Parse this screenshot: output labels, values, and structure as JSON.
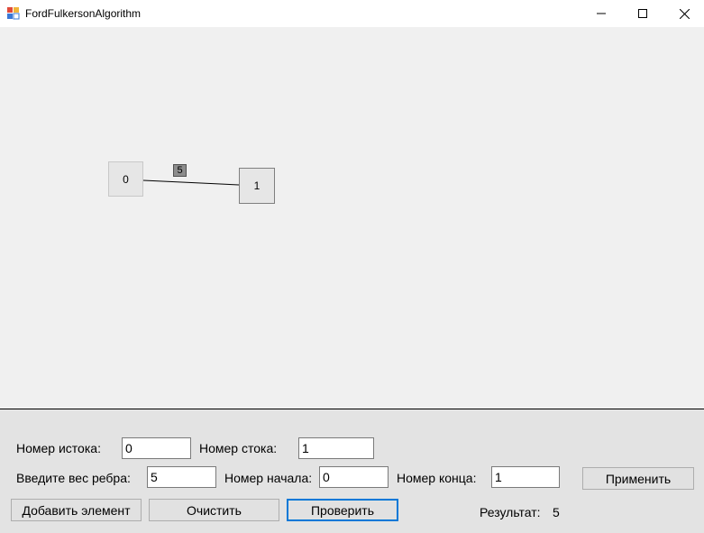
{
  "window": {
    "title": "FordFulkersonAlgorithm"
  },
  "graph": {
    "nodes": [
      {
        "label": "0"
      },
      {
        "label": "1"
      }
    ],
    "edges": [
      {
        "from": "0",
        "to": "1",
        "weight": "5"
      }
    ]
  },
  "form": {
    "source_label": "Номер истока:",
    "source_value": "0",
    "sink_label": "Номер стока:",
    "sink_value": "1",
    "weight_label": "Введите вес ребра:",
    "weight_value": "5",
    "start_label": "Номер начала:",
    "start_value": "0",
    "end_label": "Номер конца:",
    "end_value": "1",
    "apply_button": "Применить",
    "add_button": "Добавить элемент",
    "clear_button": "Очистить",
    "check_button": "Проверить",
    "result_label": "Результат:",
    "result_value": "5"
  }
}
